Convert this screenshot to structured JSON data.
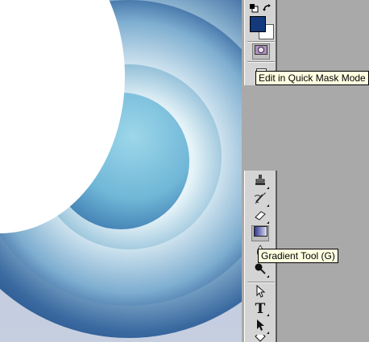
{
  "canvas": {
    "label": "document-canvas"
  },
  "colors": {
    "foreground": "#13397c",
    "background": "#ffffff"
  },
  "tooltips": {
    "quick_mask": "Edit in Quick Mask Mode",
    "gradient_tool": "Gradient Tool (G)"
  },
  "tools": {
    "type_glyph": "T",
    "top": [
      "default-colors-icon",
      "swap-colors-icon",
      "quick-mask-icon",
      "screen-mode-icon"
    ],
    "bottom": [
      "clone-stamp-icon",
      "history-brush-icon",
      "eraser-icon",
      "gradient-icon",
      "blur-icon",
      "dodge-icon",
      "path-selection-icon",
      "type-icon",
      "direct-selection-icon",
      "shape-icon"
    ]
  }
}
